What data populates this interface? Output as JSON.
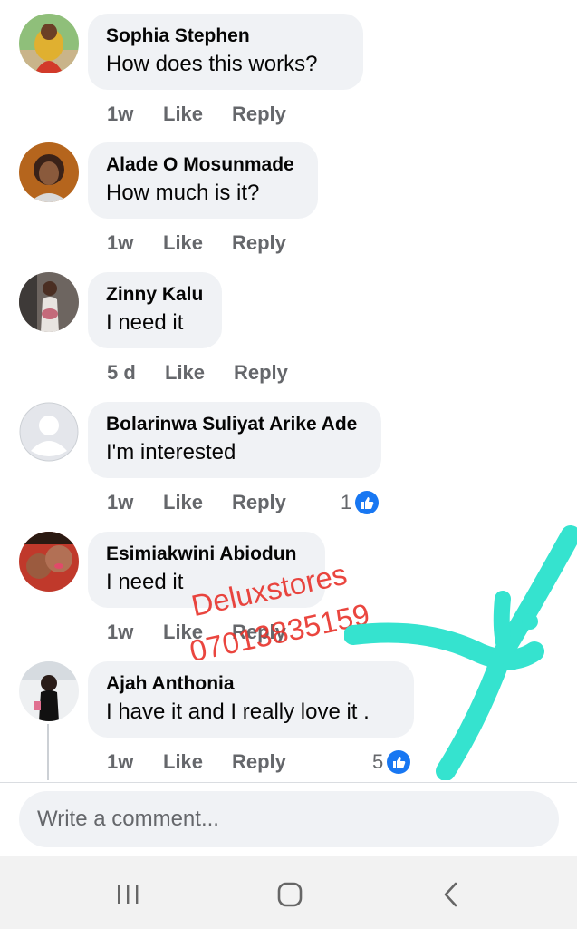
{
  "comments": [
    {
      "author": "Sophia Stephen",
      "text": "How does this works?",
      "time": "1w",
      "like": "Like",
      "reply": "Reply",
      "reactions": ""
    },
    {
      "author": "Alade O Mosunmade",
      "text": "How much is it?",
      "time": "1w",
      "like": "Like",
      "reply": "Reply",
      "reactions": ""
    },
    {
      "author": "Zinny Kalu",
      "text": "I need it",
      "time": "5 d",
      "like": "Like",
      "reply": "Reply",
      "reactions": ""
    },
    {
      "author": "Bolarinwa Suliyat Arike Ade",
      "text": "I'm interested",
      "time": "1w",
      "like": "Like",
      "reply": "Reply",
      "reactions": "1"
    },
    {
      "author": "Esimiakwini Abiodun",
      "text": "I need it",
      "time": "1w",
      "like": "Like",
      "reply": "Reply",
      "reactions": ""
    },
    {
      "author": "Ajah Anthonia",
      "text": "I have it and I really love it .",
      "time": "1w",
      "like": "Like",
      "reply": "Reply",
      "reactions": "5"
    }
  ],
  "composer": {
    "placeholder": "Write a comment..."
  },
  "watermark": {
    "line1": "Deluxstores",
    "line2": "07013835159",
    "color": "#e8322b"
  },
  "nav": {
    "recents_icon": "recents-icon",
    "home_icon": "home-icon",
    "back_icon": "back-icon"
  },
  "colors": {
    "like_blue": "#1877f2",
    "bubble": "#f0f2f5",
    "scribble": "#35e3cf"
  }
}
